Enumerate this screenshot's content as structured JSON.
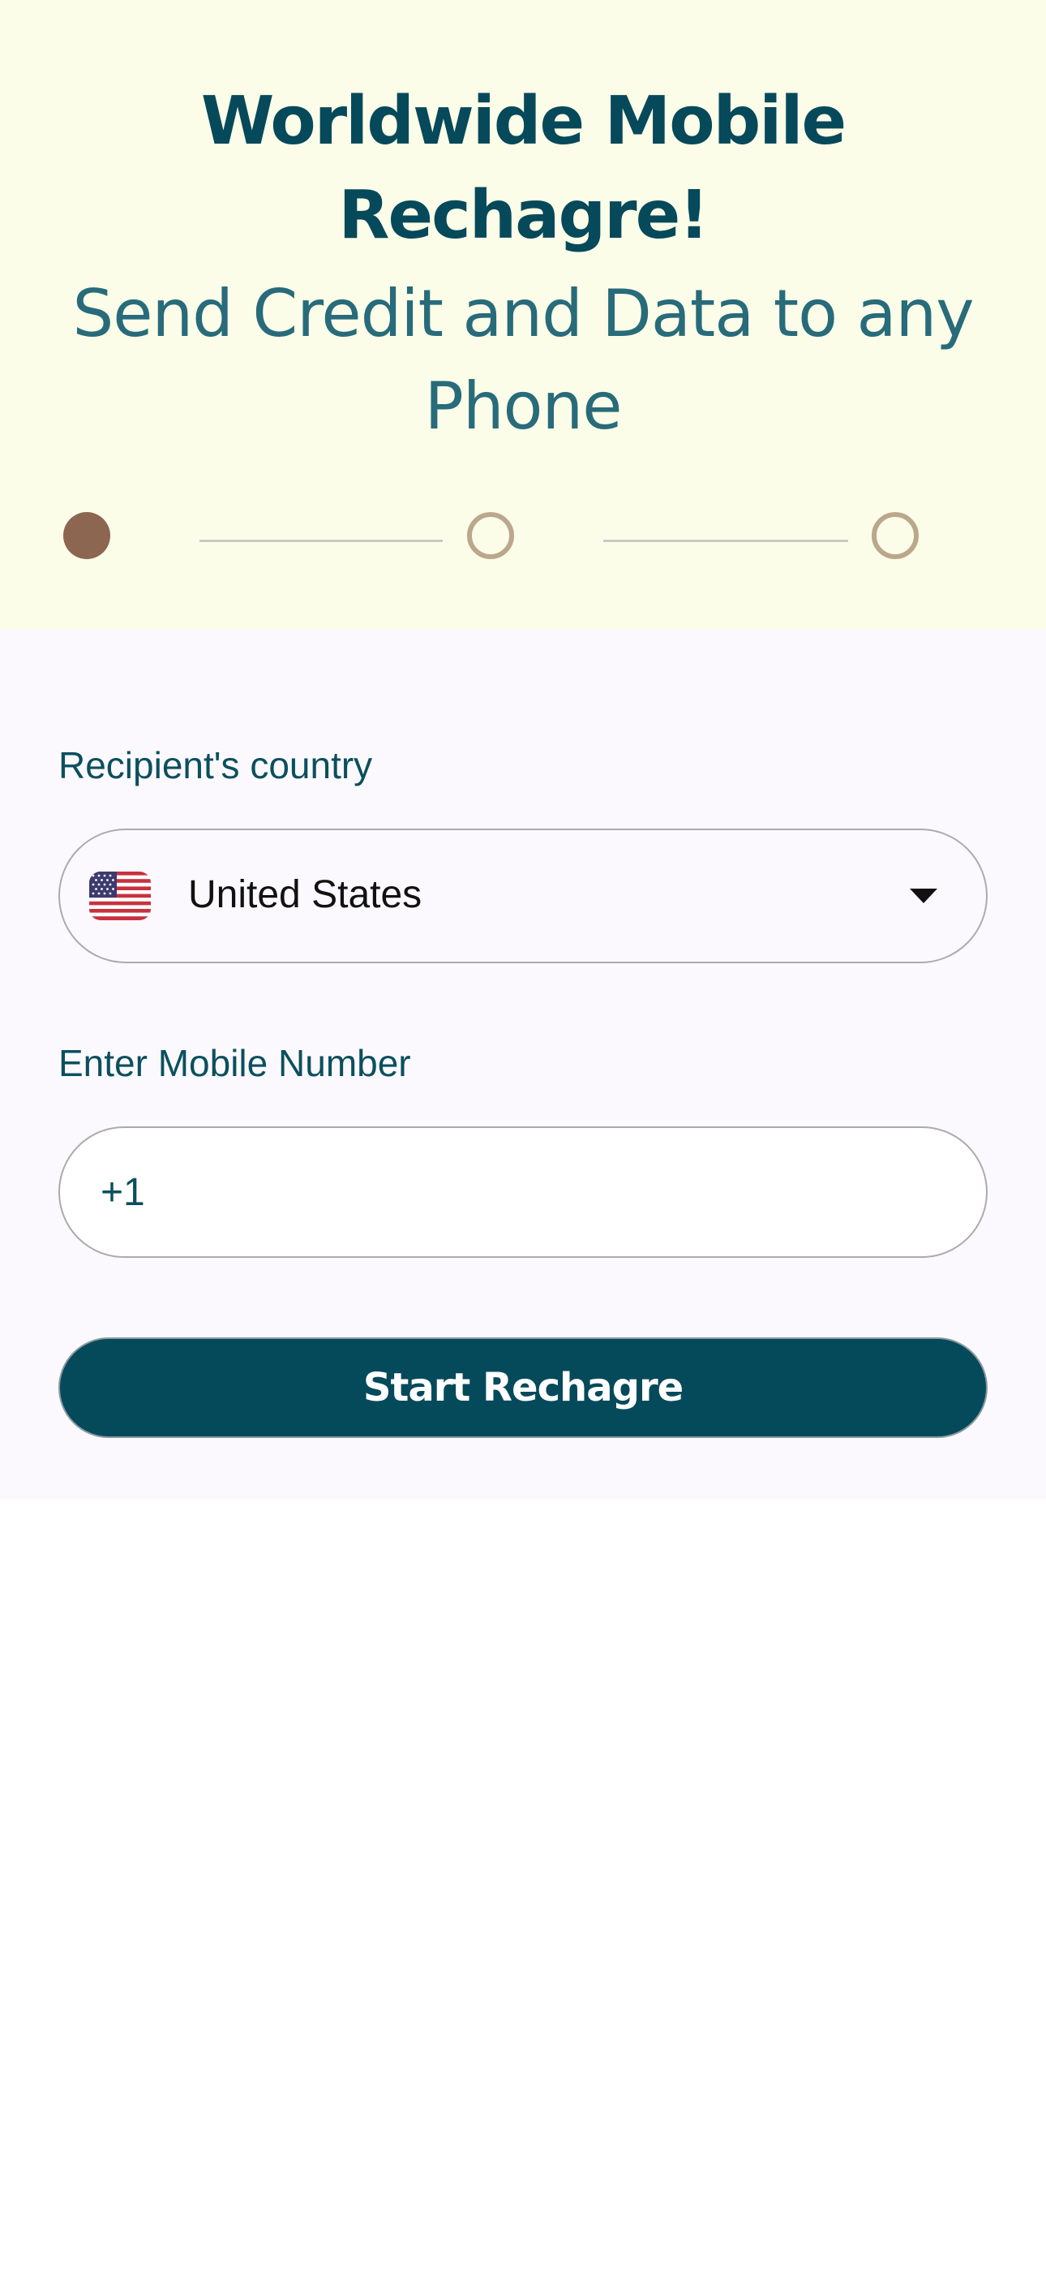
{
  "hero": {
    "title": "Worldwide Mobile Rechagre!",
    "subtitle": "Send Credit and Data to any Phone"
  },
  "steps": {
    "total": 3,
    "current": 1
  },
  "form": {
    "country_label": "Recipient's country",
    "country": {
      "selected": "United States",
      "flag_icon": "us-flag-icon",
      "dropdown_icon": "caret-down-icon"
    },
    "mobile_label": "Enter Mobile Number",
    "mobile": {
      "dial_code": "+1",
      "value": "",
      "placeholder": ""
    },
    "submit_label": "Start Rechagre"
  },
  "colors": {
    "hero_background": "#fbfde8",
    "form_background": "#fbf9fe",
    "primary": "#054a5a",
    "step_active": "#8c6650",
    "step_inactive": "#bba78c"
  }
}
